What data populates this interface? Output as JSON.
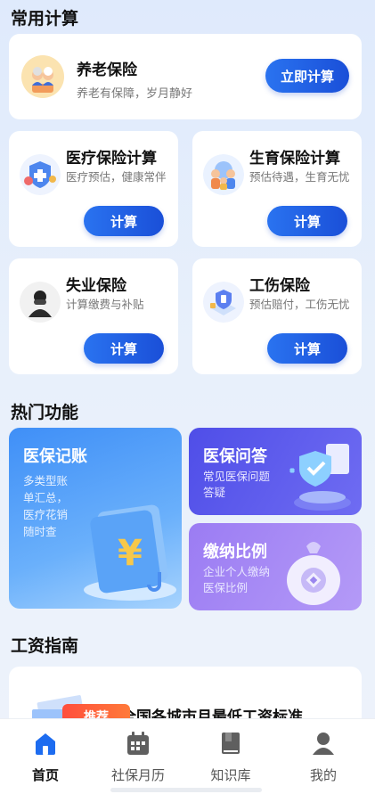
{
  "sections": {
    "common": "常用计算",
    "hot": "热门功能",
    "salary": "工资指南"
  },
  "pension": {
    "title": "养老保险",
    "subtitle": "养老有保障，岁月静好",
    "button": "立即计算"
  },
  "calc_cards": [
    {
      "title": "医疗保险计算",
      "subtitle": "医疗预估，健康常伴",
      "button": "计算",
      "icon": "medical-shield-icon"
    },
    {
      "title": "生育保险计算",
      "subtitle": "预估待遇，生育无忧",
      "button": "计算",
      "icon": "family-icon"
    },
    {
      "title": "失业保险",
      "subtitle": "计算缴费与补贴",
      "button": "计算",
      "icon": "unemployed-person-icon"
    },
    {
      "title": "工伤保险",
      "subtitle": "预估赔付，工伤无忧",
      "button": "计算",
      "icon": "injury-shield-icon"
    }
  ],
  "hot": {
    "ledger": {
      "title": "医保记账",
      "desc": "多类型账单汇总，医疗花销随时查",
      "icon": "yuan-ledger-icon"
    },
    "qa": {
      "title": "医保问答",
      "desc": "常见医保问题答疑",
      "icon": "shield-document-icon"
    },
    "ratio": {
      "title": "缴纳比例",
      "desc": "企业个人缴纳医保比例",
      "icon": "money-bag-icon"
    }
  },
  "guide": {
    "badge": "推荐",
    "title": "全国各城市月最低工资标准"
  },
  "nav": [
    {
      "label": "首页",
      "icon": "home-icon",
      "active": true
    },
    {
      "label": "社保月历",
      "icon": "calendar-icon",
      "active": false
    },
    {
      "label": "知识库",
      "icon": "book-icon",
      "active": false
    },
    {
      "label": "我的",
      "icon": "user-icon",
      "active": false
    }
  ],
  "colors": {
    "primary": "#2a73f0",
    "qa_card": "#5653ea",
    "ratio_card": "#a58af5",
    "badge": "#ff5a3c"
  }
}
